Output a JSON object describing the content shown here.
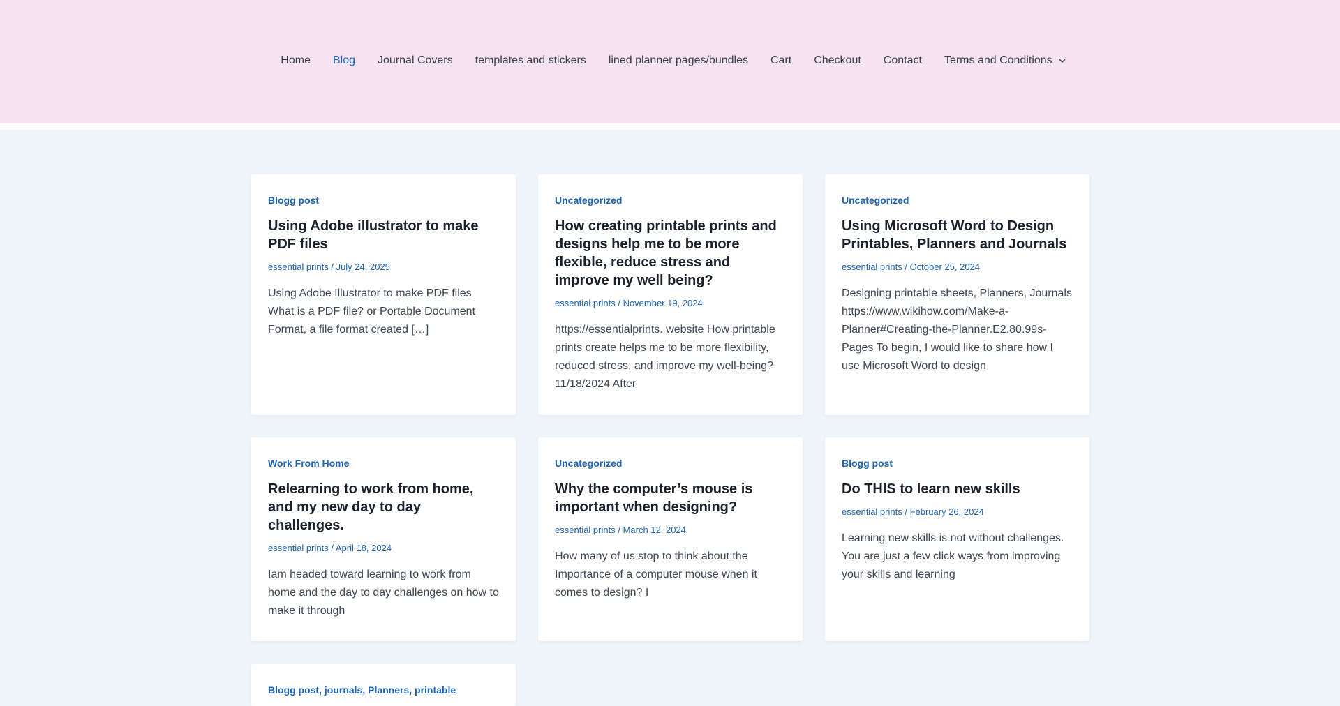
{
  "nav": {
    "items": [
      {
        "label": "Home"
      },
      {
        "label": "Blog"
      },
      {
        "label": "Journal Covers"
      },
      {
        "label": "templates and stickers"
      },
      {
        "label": "lined planner pages/bundles"
      },
      {
        "label": "Cart"
      },
      {
        "label": "Checkout"
      },
      {
        "label": "Contact"
      },
      {
        "label": "Terms and Conditions"
      }
    ],
    "active": "Blog",
    "dropdown_icon": "chevron-down-icon"
  },
  "posts": [
    {
      "category": "Blogg post",
      "title": "Using Adobe illustrator to make PDF files",
      "author": "essential prints",
      "date": "July 24, 2025",
      "excerpt": "Using Adobe Illustrator to make PDF files What is a PDF file? or Portable Document Format, a file format created […]"
    },
    {
      "category": "Uncategorized",
      "title": "How creating printable prints and designs help me to be more flexible, reduce stress and improve my well being?",
      "author": "essential prints",
      "date": "November 19, 2024",
      "excerpt": "https://essentialprints. website How  printable prints create helps me to be more  flexibility, reduced stress, and  improve my well-being?   11/18/2024 After"
    },
    {
      "category": "Uncategorized",
      "title": "Using Microsoft Word to Design Printables, Planners and Journals",
      "author": "essential prints",
      "date": "October 25, 2024",
      "excerpt": "Designing printable sheets, Planners, Journals https://www.wikihow.com/Make-a-Planner#Creating-the-Planner.E2.80.99s-Pages To begin, I would like to share how I use Microsoft Word to design"
    },
    {
      "category": "Work From Home",
      "title": "Relearning to work from home, and my new day to day challenges.",
      "author": "essential prints",
      "date": "April 18, 2024",
      "excerpt": "Iam headed toward learning to work from home and the day to day challenges on how to make it through"
    },
    {
      "category": "Uncategorized",
      "title": "Why the computer’s mouse is important when designing?",
      "author": "essential prints",
      "date": "March 12, 2024",
      "excerpt": "How many of us stop to think about the Importance of a computer mouse when it comes to design? I"
    },
    {
      "category": "Blogg post",
      "title": "Do THIS to learn new skills",
      "author": "essential prints",
      "date": "February 26, 2024",
      "excerpt": "Learning new skills is not without challenges. You are just a few click ways from improving your skills and learning"
    }
  ],
  "partial_post": {
    "category": "Blogg post, journals, Planners, printable"
  },
  "meta_separator": " / ",
  "colors": {
    "header_bg": "#f6e3f1",
    "page_bg": "#f0f5fb",
    "link": "#1e64b4",
    "title": "#1a202c"
  }
}
